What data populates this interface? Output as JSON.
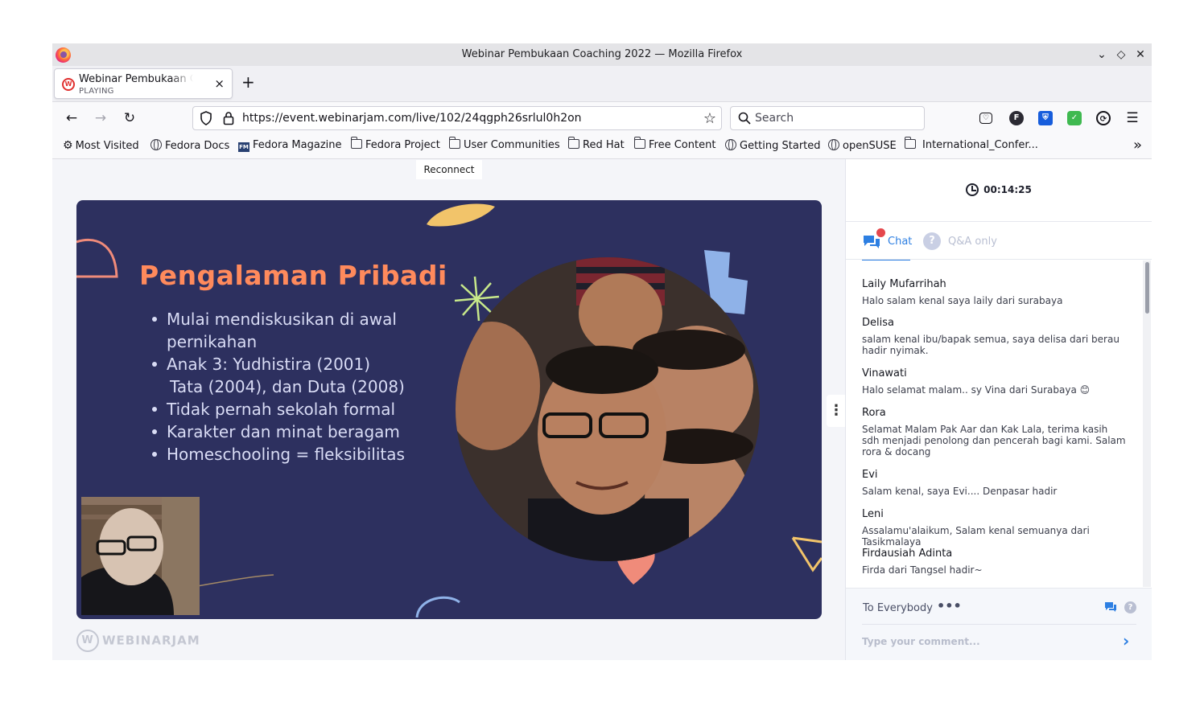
{
  "window": {
    "title": "Webinar Pembukaan Coaching 2022 — Mozilla Firefox"
  },
  "tab": {
    "title": "Webinar Pembukaan Coaching 2022",
    "status": "PLAYING"
  },
  "navbar": {
    "url": "https://event.webinarjam.com/live/102/24qgph26srlul0h2on",
    "search_placeholder": "Search"
  },
  "bookmarks": [
    {
      "label": "Most Visited",
      "icon": "gear-icon"
    },
    {
      "label": "Fedora Docs",
      "icon": "globe-icon"
    },
    {
      "label": "Fedora Magazine",
      "icon": "fedora-magazine-icon"
    },
    {
      "label": "Fedora Project",
      "icon": "folder-icon"
    },
    {
      "label": "User Communities",
      "icon": "folder-icon"
    },
    {
      "label": "Red Hat",
      "icon": "folder-icon"
    },
    {
      "label": "Free Content",
      "icon": "folder-icon"
    },
    {
      "label": "Getting Started",
      "icon": "globe-icon"
    },
    {
      "label": "openSUSE",
      "icon": "globe-icon"
    },
    {
      "label": "International_Confer...",
      "icon": "folder-icon"
    }
  ],
  "page": {
    "reconnect_label": "Reconnect",
    "brand": "WEBINARJAM"
  },
  "slide": {
    "title": "Pengalaman Pribadi",
    "bullets": [
      "Mulai mendiskusikan di awal",
      "pernikahan",
      "Anak 3: Yudhistira (2001)",
      "Tata (2004), dan Duta (2008)",
      "Tidak pernah sekolah formal",
      "Karakter dan minat beragam",
      "Homeschooling = fleksibilitas"
    ]
  },
  "chat": {
    "timer": "00:14:25",
    "tab_chat": "Chat",
    "tab_qa": "Q&A only",
    "messages": [
      {
        "name": "Laily Mufarrihah",
        "text": "Halo salam kenal saya laily dari surabaya"
      },
      {
        "name": "Delisa",
        "text": "salam kenal ibu/bapak semua, saya delisa dari berau hadir nyimak."
      },
      {
        "name": "Vinawati",
        "text": "Halo selamat malam.. sy Vina dari Surabaya 😊"
      },
      {
        "name": "Rora",
        "text": "Selamat Malam Pak Aar dan Kak Lala, terima kasih sdh menjadi penolong dan pencerah bagi kami. Salam rora & docang"
      },
      {
        "name": "Evi",
        "text": "Salam kenal, saya Evi.... Denpasar hadir"
      },
      {
        "name": "Leni",
        "text": "Assalamu'alaikum, Salam kenal semuanya dari Tasikmalaya"
      },
      {
        "name": "Firdausiah Adinta",
        "text": "Firda dari Tangsel hadir~"
      }
    ],
    "recipient": "To Everybody",
    "comment_placeholder": "Type your comment..."
  },
  "colors": {
    "accent": "#2d7fe2",
    "slide_bg": "#2d305f",
    "slide_title": "#ff8a5c",
    "notification": "#e5484d"
  }
}
